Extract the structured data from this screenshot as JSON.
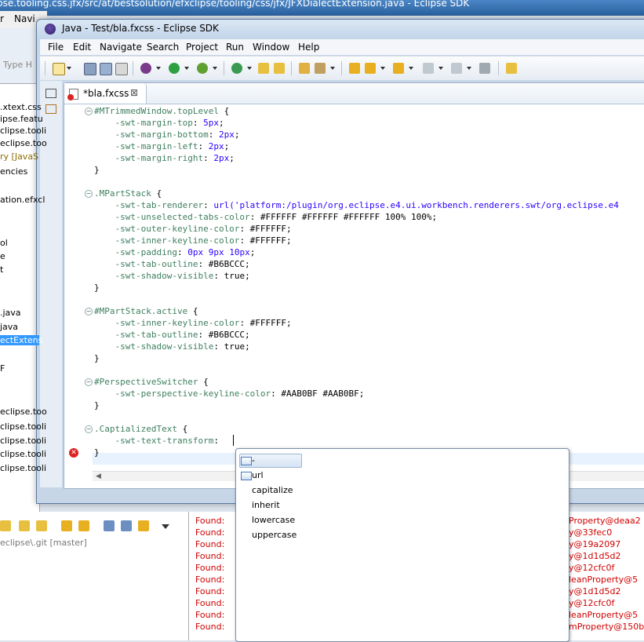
{
  "bg_window": {
    "title": "pse.tooling.css.jfx/src/at/bestsolution/efxclipse/tooling/css/jfx/JFXDialectExtension.java - Eclipse SDK",
    "menu": [
      "r",
      "Navi"
    ],
    "filter_placeholder": "Type H",
    "left_items": [
      ".xtext.css",
      "ipse.featu",
      "clipse.tooli",
      "eclipse.too",
      "ry [JavaS",
      "encies",
      "ation.efxcl",
      "ol",
      "e",
      "t",
      ".java",
      "java",
      "ectExtens",
      "F",
      "eclipse.too",
      "clipse.tooli",
      "clipse.tooli",
      "clipse.tooli",
      "clipse.tooli"
    ],
    "git_label": "eclipse\\.git [master]",
    "console_left": "Found:",
    "console_right": [
      "Property@deaa2",
      "y@33fec0",
      "y@19a2097",
      "y@1d1d5d2",
      "y@12cfc0f",
      "leanProperty@5",
      "y@1d1d5d2",
      "y@12cfc0f",
      "leanProperty@5",
      "mProperty@150b"
    ]
  },
  "window": {
    "title": "Java - Test/bla.fxcss - Eclipse SDK",
    "menu": [
      "File",
      "Edit",
      "Navigate",
      "Search",
      "Project",
      "Run",
      "Window",
      "Help"
    ]
  },
  "editor": {
    "tab_label": "*bla.fxcss",
    "tab_close": "⊠",
    "lines": [
      {
        "sel": "#MTrimmedWindow.topLevel",
        "punct": " {"
      },
      {
        "prop": "    -swt-margin-top",
        "rest": ": ",
        "val": "5px",
        "end": ";"
      },
      {
        "prop": "    -swt-margin-bottom",
        "rest": ": ",
        "val": "2px",
        "end": ";"
      },
      {
        "prop": "    -swt-margin-left",
        "rest": ": ",
        "val": "2px",
        "end": ";"
      },
      {
        "prop": "    -swt-margin-right",
        "rest": ": ",
        "val": "2px",
        "end": ";"
      },
      {
        "punct": "}"
      },
      {},
      {
        "sel": ".MPartStack",
        "punct": " {"
      },
      {
        "prop": "    -swt-tab-renderer",
        "rest": ": ",
        "val": "url('platform:/plugin/org.eclipse.e4.ui.workbench.renderers.swt/org.eclipse.e4",
        "end": ""
      },
      {
        "prop": "    -swt-unselected-tabs-color",
        "rest": ": #FFFFFF #FFFFFF #FFFFFF 100% 100%;"
      },
      {
        "prop": "    -swt-outer-keyline-color",
        "rest": ": #FFFFFF;"
      },
      {
        "prop": "    -swt-inner-keyline-color",
        "rest": ": #FFFFFF;"
      },
      {
        "prop": "    -swt-padding",
        "rest": ": ",
        "val": "0px 9px 10px",
        "end": ";"
      },
      {
        "prop": "    -swt-tab-outline",
        "rest": ": #B6BCCC;"
      },
      {
        "prop": "    -swt-shadow-visible",
        "rest": ": true;"
      },
      {
        "punct": "}"
      },
      {},
      {
        "sel": "#MPartStack.active",
        "punct": " {"
      },
      {
        "prop": "    -swt-inner-keyline-color",
        "rest": ": #FFFFFF;"
      },
      {
        "prop": "    -swt-tab-outline",
        "rest": ": #B6BCCC;"
      },
      {
        "prop": "    -swt-shadow-visible",
        "rest": ": true;"
      },
      {
        "punct": "}"
      },
      {},
      {
        "sel": "#PerspectiveSwitcher",
        "punct": " {"
      },
      {
        "prop": "    -swt-perspective-keyline-color",
        "rest": ": #AAB0BF #AAB0BF;"
      },
      {
        "punct": "}"
      },
      {},
      {
        "sel": ".CaptializedText",
        "punct": " {"
      },
      {
        "prop": "    -swt-text-transform",
        "rest": ": "
      },
      {
        "punct": "}"
      }
    ]
  },
  "content_assist": {
    "items": [
      {
        "label": "-",
        "icon": "list-icon"
      },
      {
        "label": "url",
        "icon": "list-icon"
      },
      {
        "label": "capitalize",
        "icon": ""
      },
      {
        "label": "inherit",
        "icon": ""
      },
      {
        "label": "lowercase",
        "icon": ""
      },
      {
        "label": "uppercase",
        "icon": ""
      }
    ]
  },
  "colors": {
    "selector": "#3f7f5f",
    "value": "#2a00ff",
    "error": "#d00000"
  }
}
